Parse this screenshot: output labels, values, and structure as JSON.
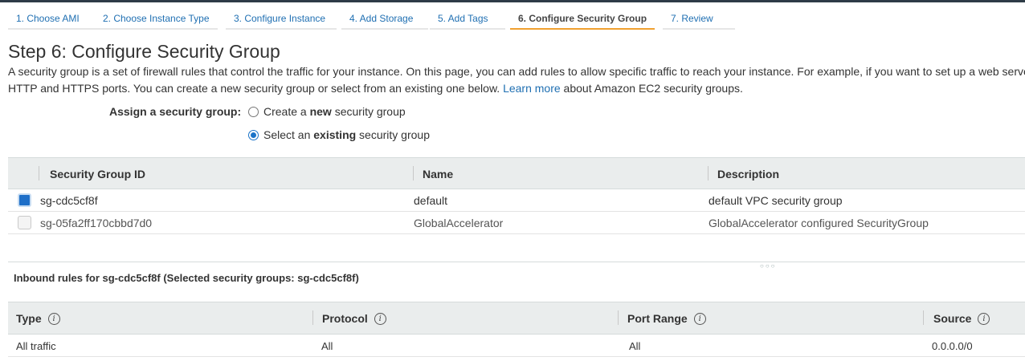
{
  "wizard": {
    "tabs": [
      {
        "label": "1. Choose AMI"
      },
      {
        "label": "2. Choose Instance Type"
      },
      {
        "label": "3. Configure Instance"
      },
      {
        "label": "4. Add Storage"
      },
      {
        "label": "5. Add Tags"
      },
      {
        "label": "6. Configure Security Group"
      },
      {
        "label": "7. Review"
      }
    ],
    "active_index": 5
  },
  "page": {
    "title": "Step 6: Configure Security Group",
    "desc_line1": "A security group is a set of firewall rules that control the traffic for your instance. On this page, you can add rules to allow specific traffic to reach your instance. For example, if you want to set up a web serve",
    "desc_line2_pre": "HTTP and HTTPS ports. You can create a new security group or select from an existing one below.",
    "learn_more": "Learn more",
    "desc_line2_post": "about Amazon EC2 security groups."
  },
  "assign": {
    "label": "Assign a security group:",
    "option_new": {
      "pre": "Create a ",
      "bold": "new",
      "post": " security group",
      "selected": false
    },
    "option_existing": {
      "pre": "Select an ",
      "bold": "existing",
      "post": " security group",
      "selected": true
    }
  },
  "security_groups": {
    "headers": {
      "id": "Security Group ID",
      "name": "Name",
      "description": "Description"
    },
    "rows": [
      {
        "id": "sg-cdc5cf8f",
        "name": "default",
        "description": "default VPC security group",
        "checked": true
      },
      {
        "id": "sg-05fa2ff170cbbd7d0",
        "name": "GlobalAccelerator",
        "description": "GlobalAccelerator configured SecurityGroup",
        "checked": false
      }
    ]
  },
  "inbound": {
    "title": "Inbound rules for sg-cdc5cf8f (Selected security groups: sg-cdc5cf8f)",
    "headers": {
      "type": "Type",
      "protocol": "Protocol",
      "port_range": "Port Range",
      "source": "Source"
    },
    "info_glyph": "i",
    "rows": [
      {
        "type": "All traffic",
        "protocol": "All",
        "port_range": "All",
        "source": "0.0.0.0/0"
      }
    ]
  },
  "colors": {
    "link": "#1f6fb2",
    "active_tab_underline": "#f0a030",
    "checkbox_checked": "#1e6fc8",
    "table_header_bg": "#eaeded"
  }
}
